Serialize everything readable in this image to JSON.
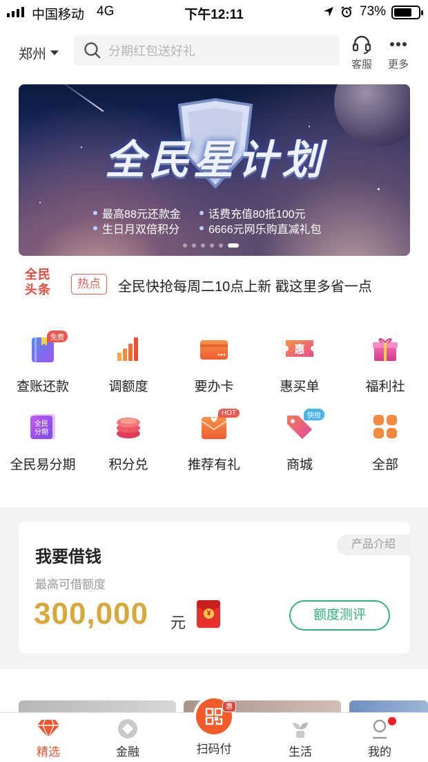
{
  "status_bar": {
    "carrier": "中国移动",
    "network": "4G",
    "time": "下午12:11",
    "battery": "73%",
    "battery_level": 0.73
  },
  "header": {
    "city": "郑州",
    "search_placeholder": "分期红包送好礼",
    "service_label": "客服",
    "more_label": "更多"
  },
  "banner": {
    "title": "全民星计划",
    "features": [
      "最高88元还款金",
      "话费充值80抵100元",
      "生日月双倍积分",
      "6666元网乐购直减礼包"
    ],
    "page_count": 6,
    "active_page": 6
  },
  "headline": {
    "logo_line1": "全民",
    "logo_line2": "头条",
    "tag": "热点",
    "text": "全民快抢每周二10点上新 戳这里多省一点"
  },
  "services": [
    {
      "label": "查账还款",
      "icon": "bill-book-icon",
      "badge": "免费",
      "badge_color": "#e85a4f"
    },
    {
      "label": "调额度",
      "icon": "bar-chart-icon",
      "badge": "",
      "badge_color": ""
    },
    {
      "label": "要办卡",
      "icon": "credit-card-icon",
      "badge": "",
      "badge_color": ""
    },
    {
      "label": "惠买单",
      "icon": "discount-ticket-icon",
      "badge": "",
      "badge_color": ""
    },
    {
      "label": "福利社",
      "icon": "gift-box-icon",
      "badge": "",
      "badge_color": ""
    },
    {
      "label": "全民易分期",
      "icon": "installment-icon",
      "badge": "",
      "badge_color": "",
      "icon_text1": "全民",
      "icon_text2": "分期"
    },
    {
      "label": "积分兑",
      "icon": "coin-stack-icon",
      "badge": "",
      "badge_color": ""
    },
    {
      "label": "推荐有礼",
      "icon": "envelope-heart-icon",
      "badge": "HOT",
      "badge_color": "#e85a4f"
    },
    {
      "label": "商城",
      "icon": "price-tag-icon",
      "badge": "快抢",
      "badge_color": "#4ab3e8"
    },
    {
      "label": "全部",
      "icon": "all-grid-icon",
      "badge": "",
      "badge_color": ""
    }
  ],
  "hui_glyph": "惠",
  "loan": {
    "title": "我要借钱",
    "intro_button": "产品介绍",
    "subtitle": "最高可借额度",
    "amount": "300,000",
    "unit": "元",
    "red_packet_symbol": "¥",
    "eval_button": "额度测评"
  },
  "tabbar": {
    "items": [
      {
        "label": "精选",
        "icon": "diamond-icon",
        "active": true
      },
      {
        "label": "金融",
        "icon": "finance-icon",
        "active": false
      },
      {
        "label": "扫码付",
        "icon": "qr-scan-icon",
        "active": false
      },
      {
        "label": "生活",
        "icon": "plant-icon",
        "active": false
      },
      {
        "label": "我的",
        "icon": "person-icon",
        "active": false
      }
    ],
    "scan_badge": "惠"
  },
  "colors": {
    "accent": "#f0562f",
    "gold": "#d6a93d",
    "green": "#2fb37a",
    "hot_red": "#e94a3f"
  }
}
